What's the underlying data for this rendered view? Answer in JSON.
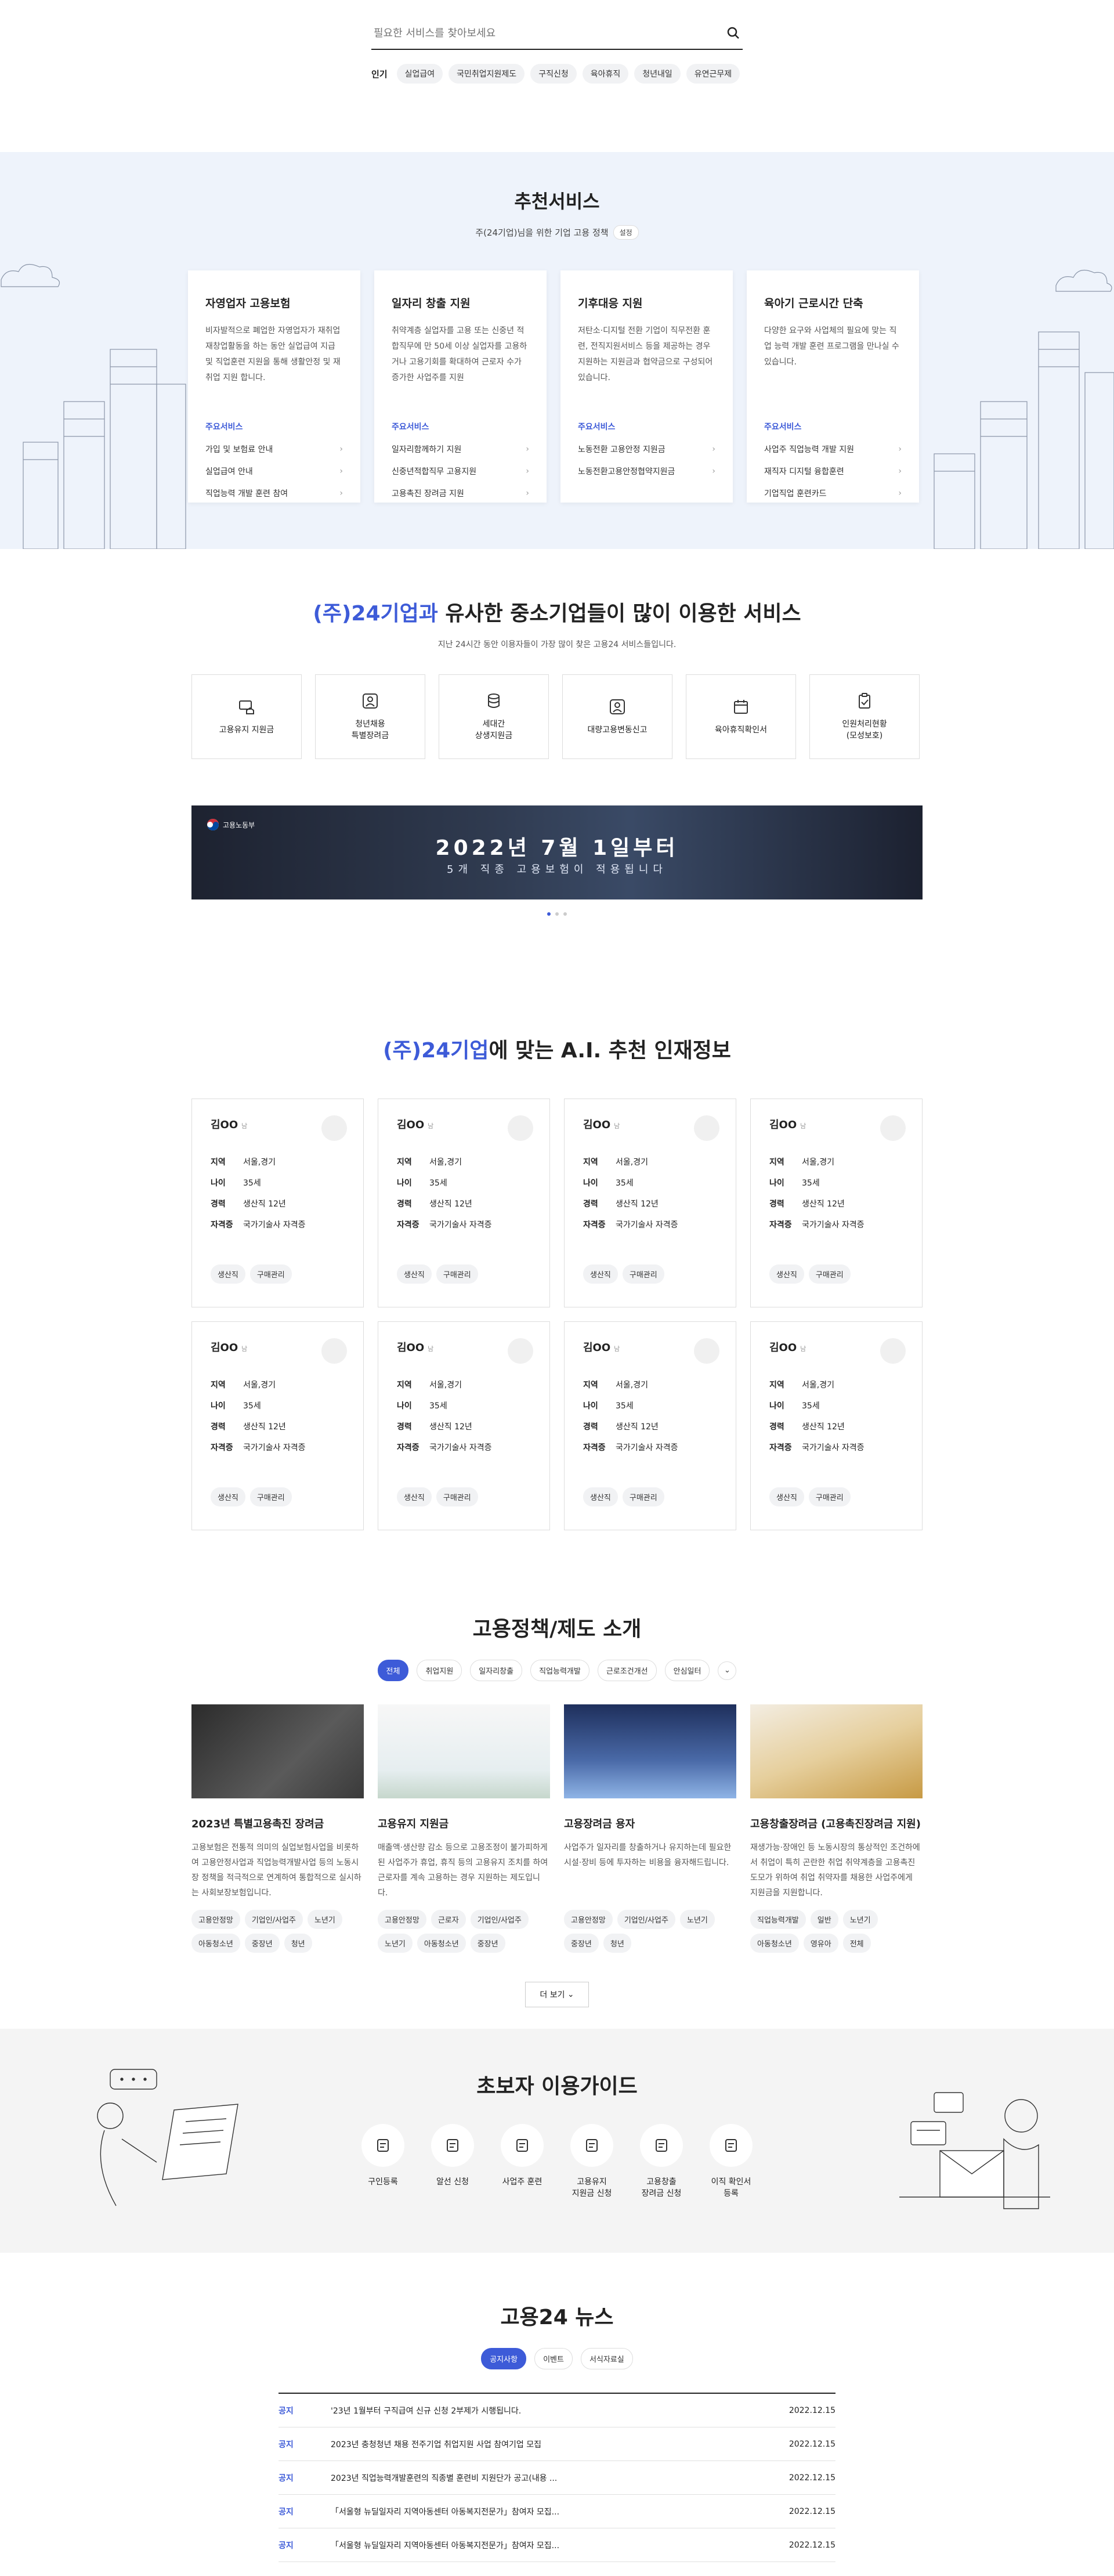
{
  "search": {
    "placeholder": "필요한 서비스를 찾아보세요",
    "popular_label": "인기",
    "keywords": [
      "실업급여",
      "국민취업지원제도",
      "구직신청",
      "육아휴직",
      "청년내일",
      "유연근무제"
    ]
  },
  "recommend": {
    "title": "추천서비스",
    "subtitle": "주(24기업)님을 위한 기업 고용 정책",
    "settings_label": "설정",
    "main_services_label": "주요서비스",
    "cards": [
      {
        "title": "자영업자 고용보험",
        "desc": "비자발적으로 폐업한 자영업자가 재취업 재창업활동을 하는 동안 실업급여 지급 및 직업훈련 지원을 통해 생활안정 및 재취업 지원 합니다.",
        "items": [
          "가입 및 보험료 안내",
          "실업급여 안내",
          "직업능력 개발 훈련 참여"
        ]
      },
      {
        "title": "일자리 창출 지원",
        "desc": "취약계층 실업자를 고용 또는 신중년 적합직무에 만 50세 이상 실업자를 고용하거나 고용기회를 확대하여 근로자 수가 증가한 사업주를 지원",
        "items": [
          "일자리함께하기 지원",
          "신중년적합직무 고용지원",
          "고용촉진 장려금 지원"
        ]
      },
      {
        "title": "기후대응 지원",
        "desc": "저탄소·디지털 전환 기업이 직무전환 훈련, 전직지원서비스 등을 제공하는 경우 지원하는 지원금과 협약금으로 구성되어 있습니다.",
        "items": [
          "노동전환 고용안정 지원금",
          "노동전환고용안정협약지원금"
        ]
      },
      {
        "title": "육아기 근로시간 단축",
        "desc": "다양한 요구와 사업체의 필요에 맞는 직업 능력 개발 훈련 프로그램을 만나실 수 있습니다.",
        "items": [
          "사업주 직업능력 개발 지원",
          "재직자 디지털 융합훈련",
          "기업직업 훈련카드"
        ]
      }
    ]
  },
  "similar": {
    "title_highlight": "(주)24기업과",
    "title_rest": " 유사한 중소기업들이 많이 이용한 서비스",
    "subtitle": "지난 24시간 동안 이용자들이 가장 많이 찾은 고용24 서비스들입니다.",
    "services": [
      {
        "label": "고용유지 지원금"
      },
      {
        "label": "청년채용\n특별장려금"
      },
      {
        "label": "세대간\n상생지원금"
      },
      {
        "label": "대량고용변동신고"
      },
      {
        "label": "육아휴직확인서"
      },
      {
        "label": "인원처리현황\n(모성보호)"
      }
    ],
    "banner": {
      "logo": "고용노동부",
      "line1": "2022년 7월 1일부터",
      "line2": "5개 직종 고용보험이 적용됩니다"
    }
  },
  "ai": {
    "title_highlight": "(주)24기업",
    "title_rest": "에 맞는 A.I. 추천 인재정보",
    "labels": {
      "region": "지역",
      "age": "나이",
      "career": "경력",
      "cert": "자격증"
    },
    "people": [
      {
        "name": "김OO",
        "sex": "남",
        "region": "서울,경기",
        "age": "35세",
        "career": "생산직 12년",
        "cert": "국가기술사 자격증",
        "tags": [
          "생산직",
          "구매관리"
        ]
      },
      {
        "name": "김OO",
        "sex": "남",
        "region": "서울,경기",
        "age": "35세",
        "career": "생산직 12년",
        "cert": "국가기술사 자격증",
        "tags": [
          "생산직",
          "구매관리"
        ]
      },
      {
        "name": "김OO",
        "sex": "남",
        "region": "서울,경기",
        "age": "35세",
        "career": "생산직 12년",
        "cert": "국가기술사 자격증",
        "tags": [
          "생산직",
          "구매관리"
        ]
      },
      {
        "name": "김OO",
        "sex": "남",
        "region": "서울,경기",
        "age": "35세",
        "career": "생산직 12년",
        "cert": "국가기술사 자격증",
        "tags": [
          "생산직",
          "구매관리"
        ]
      },
      {
        "name": "김OO",
        "sex": "남",
        "region": "서울,경기",
        "age": "35세",
        "career": "생산직 12년",
        "cert": "국가기술사 자격증",
        "tags": [
          "생산직",
          "구매관리"
        ]
      },
      {
        "name": "김OO",
        "sex": "남",
        "region": "서울,경기",
        "age": "35세",
        "career": "생산직 12년",
        "cert": "국가기술사 자격증",
        "tags": [
          "생산직",
          "구매관리"
        ]
      },
      {
        "name": "김OO",
        "sex": "남",
        "region": "서울,경기",
        "age": "35세",
        "career": "생산직 12년",
        "cert": "국가기술사 자격증",
        "tags": [
          "생산직",
          "구매관리"
        ]
      },
      {
        "name": "김OO",
        "sex": "남",
        "region": "서울,경기",
        "age": "35세",
        "career": "생산직 12년",
        "cert": "국가기술사 자격증",
        "tags": [
          "생산직",
          "구매관리"
        ]
      }
    ]
  },
  "policy": {
    "title": "고용정책/제도 소개",
    "tabs": [
      "전체",
      "취업지원",
      "일자리창출",
      "직업능력개발",
      "근로조건개선",
      "안심일터"
    ],
    "items": [
      {
        "title": "2023년 특별고용촉진 장려금",
        "desc": "고용보험은 전통적 의미의 실업보험사업을 비롯하여 고용안정사업과 직업능력개발사업 등의 노동시장 정책을 적극적으로 연계하여 통합적으로 실시하는 사회보장보험입니다.",
        "tags": [
          "고용안정망",
          "기업인/사업주",
          "노년기",
          "아동청소년",
          "중장년",
          "청년"
        ]
      },
      {
        "title": "고용유지 지원금",
        "desc": "매출액·생산량 감소 등으로 고용조정이 불가피하게 된 사업주가 휴업, 휴직 등의 고용유지 조치를 하여 근로자를 계속 고용하는 경우 지원하는 제도입니다.",
        "tags": [
          "고용안정망",
          "근로자",
          "기업인/사업주",
          "노년기",
          "아동청소년",
          "중장년"
        ]
      },
      {
        "title": "고용장려금 용자",
        "desc": "사업주가 일자리를 창출하거나 유지하는데 필요한 시설·장비 등에 투자하는 비용을 융자해드립니다.",
        "tags": [
          "고용안정망",
          "기업인/사업주",
          "노년기",
          "중장년",
          "청년"
        ]
      },
      {
        "title": "고용창출장려금 (고용촉진장려금 지원)",
        "desc": "재생가능·장애인 등 노동시장의 통상적인 조건하에서 취업이 특히 곤란한 취업 취약계층을 고용촉진 도모가 위하여 취업 취약자를 채용한 사업주에게 지원금을 지원합니다.",
        "tags": [
          "직업능력개발",
          "일반",
          "노년기",
          "아동청소년",
          "영유아",
          "전체"
        ]
      }
    ],
    "more_label": "더 보기"
  },
  "guide": {
    "title": "초보자 이용가이드",
    "steps": [
      {
        "label": "구인등록",
        "icon": "register-icon"
      },
      {
        "label": "알선 신청",
        "icon": "calendar-icon"
      },
      {
        "label": "사업주 훈련",
        "icon": "grid-icon"
      },
      {
        "label": "고용유지\n지원금 신청",
        "icon": "document-icon"
      },
      {
        "label": "고용창출\n장려금 신청",
        "icon": "coin-icon"
      },
      {
        "label": "이직 확인서\n등록",
        "icon": "person-card-icon"
      }
    ]
  },
  "news": {
    "title": "고용24 뉴스",
    "tabs": [
      "공지사항",
      "이벤트",
      "서식자료실"
    ],
    "rows": [
      {
        "cat": "공지",
        "title": "'23년 1월부터 구직급여 신규 신청 2부제가 시행됩니다.",
        "date": "2022.12.15"
      },
      {
        "cat": "공지",
        "title": "2023년 충청청년 채용 전주기업 취업지원 사업 참여기업 모집",
        "date": "2022.12.15"
      },
      {
        "cat": "공지",
        "title": "2023년 직업능력개발훈련의 직종별 훈련비 지원단가 공고(내용 ...",
        "date": "2022.12.15"
      },
      {
        "cat": "공지",
        "title": "「서울형 뉴딜일자리 지역아동센터 아동복지전문가」참여자 모집...",
        "date": "2022.12.15"
      },
      {
        "cat": "공지",
        "title": "「서울형 뉴딜일자리 지역아동센터 아동복지전문가」참여자 모집...",
        "date": "2022.12.15"
      }
    ]
  }
}
